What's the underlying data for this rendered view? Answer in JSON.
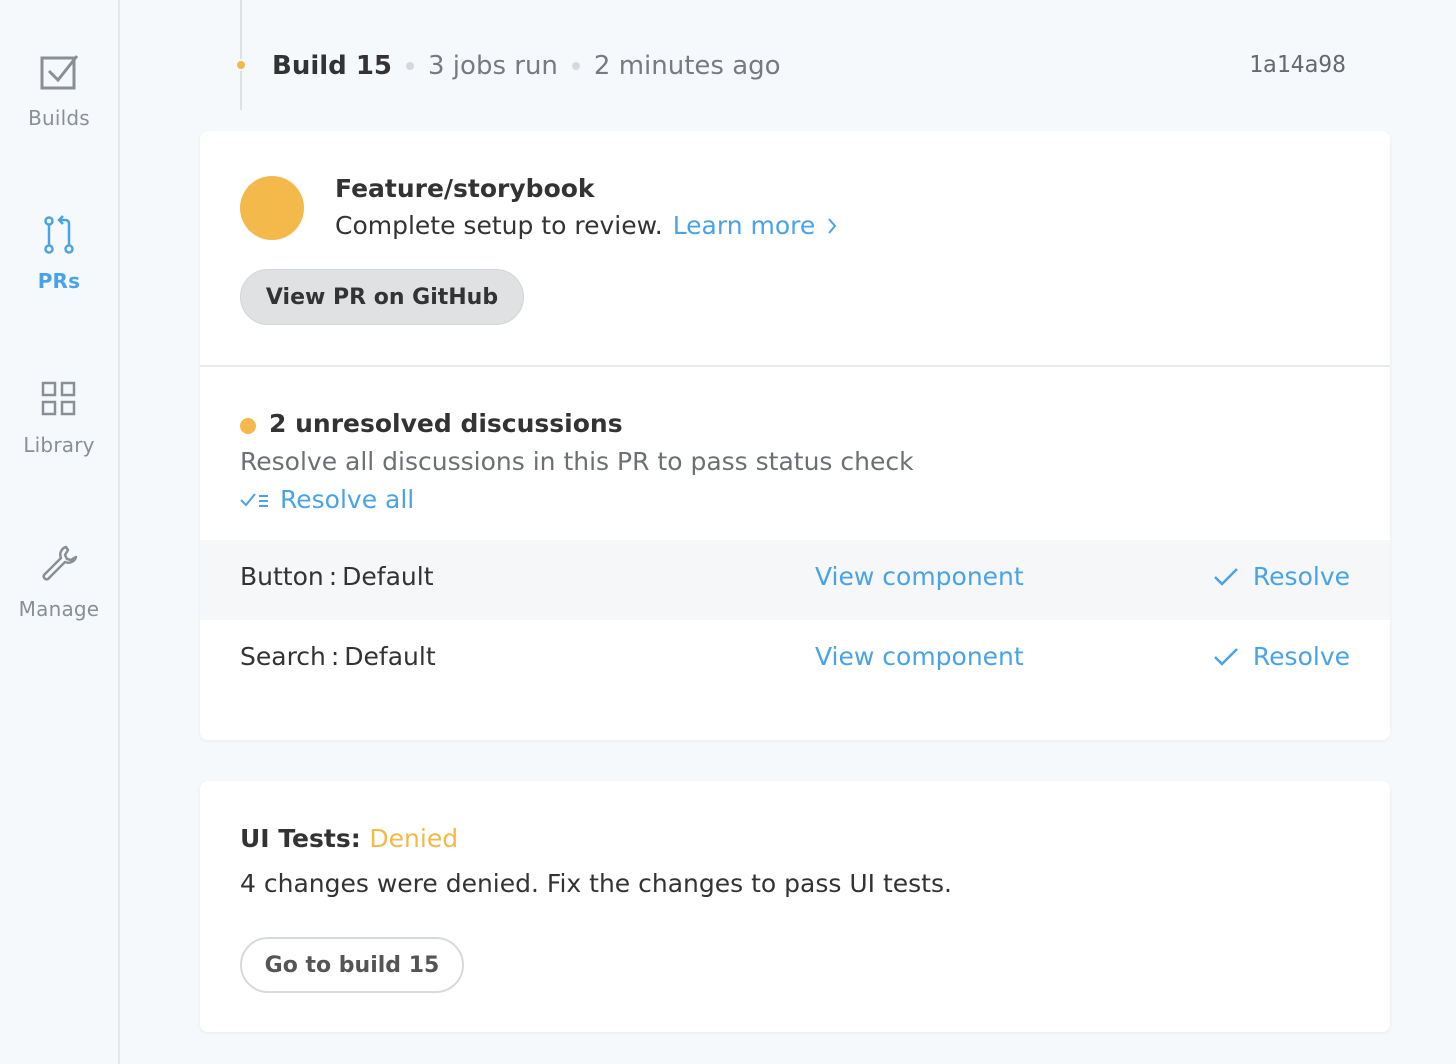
{
  "sidebar": {
    "items": [
      {
        "label": "Builds",
        "icon": "builds-checkbox-icon",
        "active": false
      },
      {
        "label": "PRs",
        "icon": "pull-request-icon",
        "active": true
      },
      {
        "label": "Library",
        "icon": "grid-icon",
        "active": false
      },
      {
        "label": "Manage",
        "icon": "wrench-icon",
        "active": false
      }
    ]
  },
  "build": {
    "title": "Build 15",
    "jobs": "3 jobs run",
    "time": "2 minutes ago",
    "commit": "1a14a98",
    "status_color": "#f3b94a"
  },
  "pr": {
    "title": "Feature/storybook",
    "description": "Complete setup to review.",
    "learn_more": "Learn more",
    "github_button": "View PR on GitHub"
  },
  "discussions": {
    "title": "2 unresolved discussions",
    "description": "Resolve all discussions in this PR to pass status check",
    "resolve_all": "Resolve all",
    "rows": [
      {
        "name": "Button : Default",
        "view": "View component",
        "resolve": "Resolve"
      },
      {
        "name": "Search : Default",
        "view": "View component",
        "resolve": "Resolve"
      }
    ]
  },
  "ui_tests": {
    "label": "UI Tests:",
    "status": "Denied",
    "description": "4 changes were denied. Fix the changes to pass UI tests.",
    "button": "Go to build 15"
  },
  "colors": {
    "accent": "#4aa3e8",
    "warning": "#f3b94a",
    "background": "#f6f9fc"
  }
}
